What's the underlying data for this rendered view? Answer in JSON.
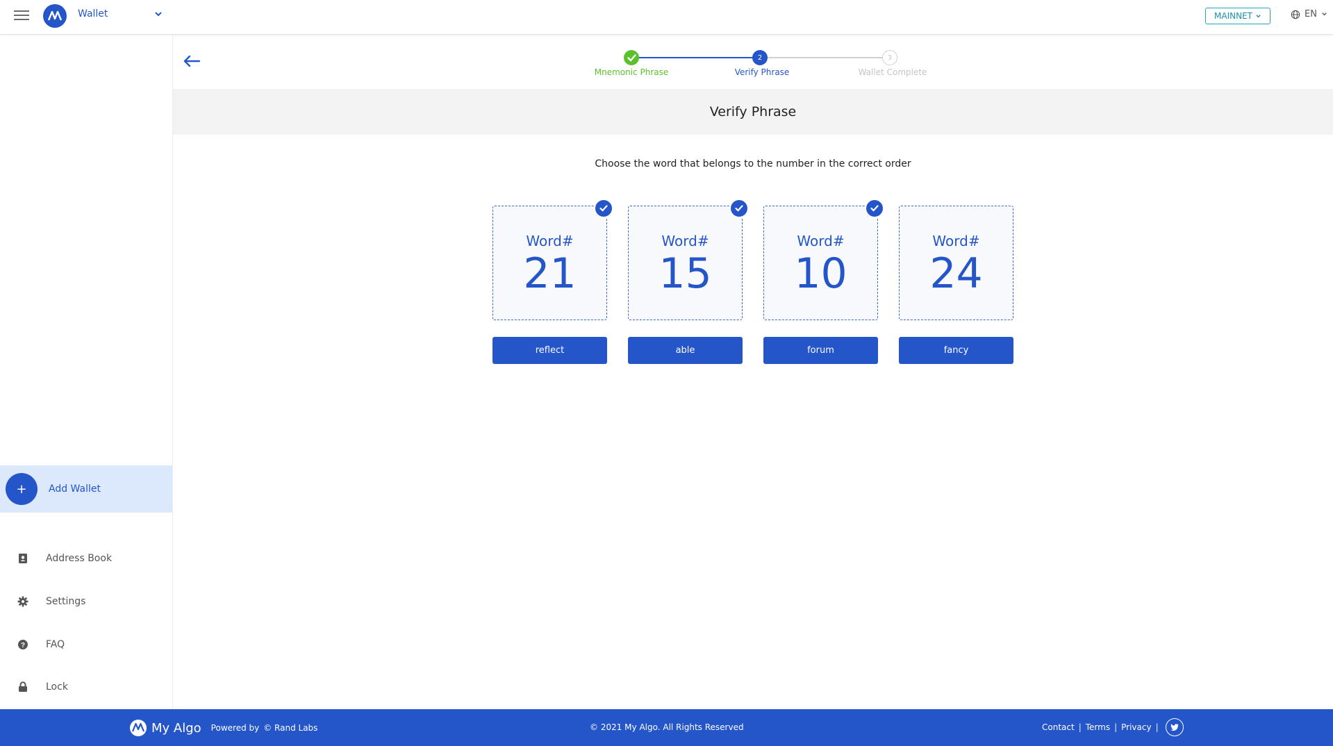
{
  "topbar": {
    "wallet_name": "Wallet",
    "network": "MAINNET",
    "language": "EN"
  },
  "sidebar": {
    "add_wallet": "Add Wallet",
    "items": [
      {
        "label": "Address Book",
        "icon": "address-book-icon"
      },
      {
        "label": "Settings",
        "icon": "gear-icon"
      },
      {
        "label": "FAQ",
        "icon": "question-icon"
      },
      {
        "label": "Lock",
        "icon": "lock-icon"
      }
    ]
  },
  "stepper": {
    "steps": [
      {
        "label": "Mnemonic Phrase",
        "state": "done"
      },
      {
        "label": "Verify Phrase",
        "number": "2",
        "state": "active"
      },
      {
        "label": "Wallet Complete",
        "number": "3",
        "state": "pending"
      }
    ]
  },
  "main": {
    "title": "Verify Phrase",
    "instruction": "Choose the word that belongs to the number in the correct order",
    "cards": [
      {
        "label": "Word#",
        "number": "21",
        "checked": true
      },
      {
        "label": "Word#",
        "number": "15",
        "checked": true
      },
      {
        "label": "Word#",
        "number": "10",
        "checked": true
      },
      {
        "label": "Word#",
        "number": "24",
        "checked": false
      }
    ],
    "choices": [
      "reflect",
      "able",
      "forum",
      "fancy"
    ]
  },
  "footer": {
    "brand": "My Algo",
    "powered_by": "Powered by",
    "powered_company": "© Rand Labs",
    "copyright": "© 2021 My Algo.  All Rights Reserved",
    "links": [
      "Contact",
      "Terms",
      "Privacy"
    ]
  },
  "colors": {
    "primary": "#2456c9",
    "success": "#5bc12b",
    "mainnet": "#22a7c2"
  }
}
